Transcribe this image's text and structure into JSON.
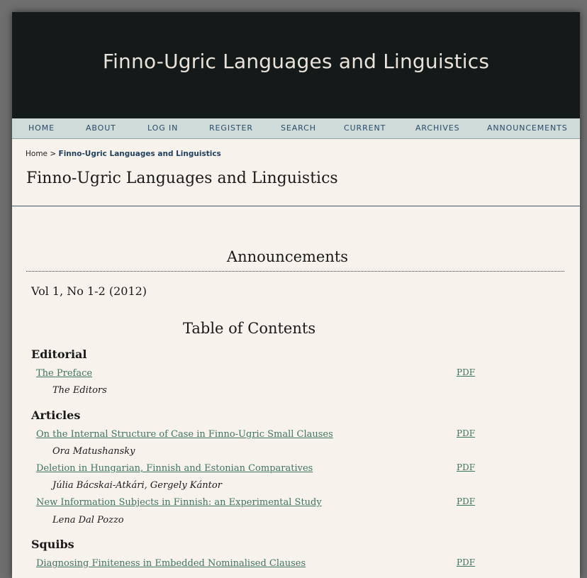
{
  "site_title": "Finno-Ugric Languages and Linguistics",
  "nav": {
    "items": [
      "HOME",
      "ABOUT",
      "LOG IN",
      "REGISTER",
      "SEARCH",
      "CURRENT",
      "ARCHIVES",
      "ANNOUNCEMENTS"
    ]
  },
  "breadcrumb": {
    "home": "Home",
    "separator": ">",
    "current": "Finno-Ugric Languages and Linguistics"
  },
  "page_title": "Finno-Ugric Languages and Linguistics",
  "announcements_heading": "Announcements",
  "issue": "Vol 1, No 1-2 (2012)",
  "toc_heading": "Table of Contents",
  "sections": [
    {
      "title": "Editorial",
      "articles": [
        {
          "title": "The Preface",
          "authors": "The Editors",
          "galley": "PDF"
        }
      ]
    },
    {
      "title": "Articles",
      "articles": [
        {
          "title": "On the Internal Structure of Case in Finno-Ugric Small Clauses",
          "authors": "Ora Matushansky",
          "galley": "PDF"
        },
        {
          "title": "Deletion in Hungarian, Finnish and Estonian Comparatives",
          "authors": "Júlia Bácskai-Atkári, Gergely Kántor",
          "galley": "PDF"
        },
        {
          "title": "New Information Subjects in Finnish: an Experimental Study",
          "authors": "Lena Dal Pozzo",
          "galley": "PDF"
        }
      ]
    },
    {
      "title": "Squibs",
      "articles": [
        {
          "title": "Diagnosing Finiteness in Embedded Nominalised Clauses",
          "galley": "PDF"
        }
      ]
    }
  ],
  "colors": {
    "header_bg": "#141a19",
    "navbar_bg": "#cfdbd8",
    "content_bg": "#f7f2ec",
    "link": "#3f7460"
  }
}
